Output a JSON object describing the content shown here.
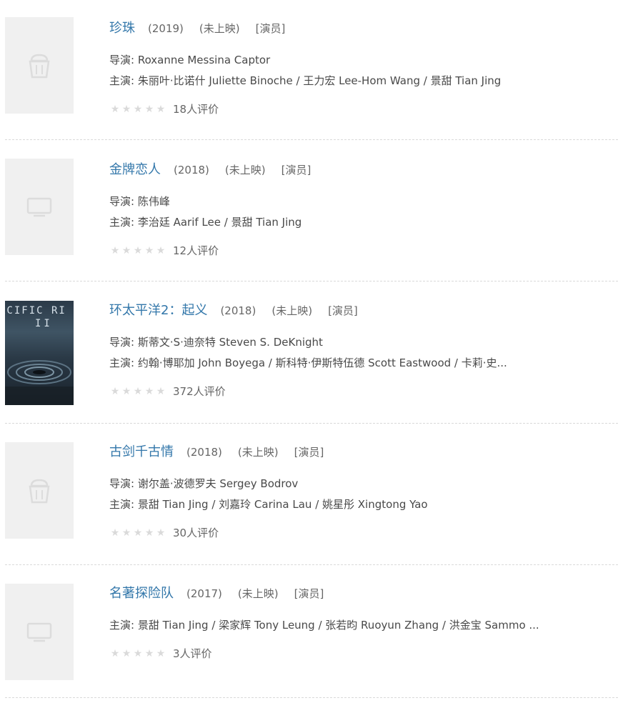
{
  "rating_star_count": 5,
  "colors": {
    "title_link": "#3377aa",
    "placeholder_bg": "#f0f0f0",
    "star_empty": "#dadada",
    "divider": "#d9d9d9"
  },
  "items": [
    {
      "title": "珍珠",
      "year": "(2019)",
      "status": "(未上映)",
      "role": "[演员]",
      "poster": "placeholder-cup-icon",
      "director": "导演: Roxanne Messina Captor",
      "cast": "主演: 朱丽叶·比诺什 Juliette Binoche / 王力宏 Lee-Hom Wang / 景甜 Tian Jing",
      "rating_count": "18人评价"
    },
    {
      "title": "金牌恋人",
      "year": "(2018)",
      "status": "(未上映)",
      "role": "[演员]",
      "poster": "placeholder-tv-icon",
      "director": "导演: 陈伟峰",
      "cast": "主演: 李治廷 Aarif Lee / 景甜 Tian Jing",
      "rating_count": "12人评价"
    },
    {
      "title": "环太平洋2：起义",
      "year": "(2018)",
      "status": "(未上映)",
      "role": "[演员]",
      "poster": "poster-image",
      "poster_text": "ACIFIC RI",
      "poster_sub": "II",
      "director": "导演: 斯蒂文·S·迪奈特 Steven S. DeKnight",
      "cast": "主演: 约翰·博耶加 John Boyega / 斯科特·伊斯特伍德 Scott Eastwood / 卡莉·史...",
      "rating_count": "372人评价"
    },
    {
      "title": "古剑千古情",
      "year": "(2018)",
      "status": "(未上映)",
      "role": "[演员]",
      "poster": "placeholder-cup-icon",
      "director": "导演: 谢尔盖·波德罗夫 Sergey Bodrov",
      "cast": "主演: 景甜 Tian Jing / 刘嘉玲 Carina Lau / 姚星彤 Xingtong Yao",
      "rating_count": "30人评价"
    },
    {
      "title": "名著探险队",
      "year": "(2017)",
      "status": "(未上映)",
      "role": "[演员]",
      "poster": "placeholder-tv-icon",
      "cast": "主演: 景甜 Tian Jing / 梁家辉 Tony Leung / 张若昀 Ruoyun Zhang / 洪金宝 Sammo ...",
      "rating_count": "3人评价"
    }
  ]
}
